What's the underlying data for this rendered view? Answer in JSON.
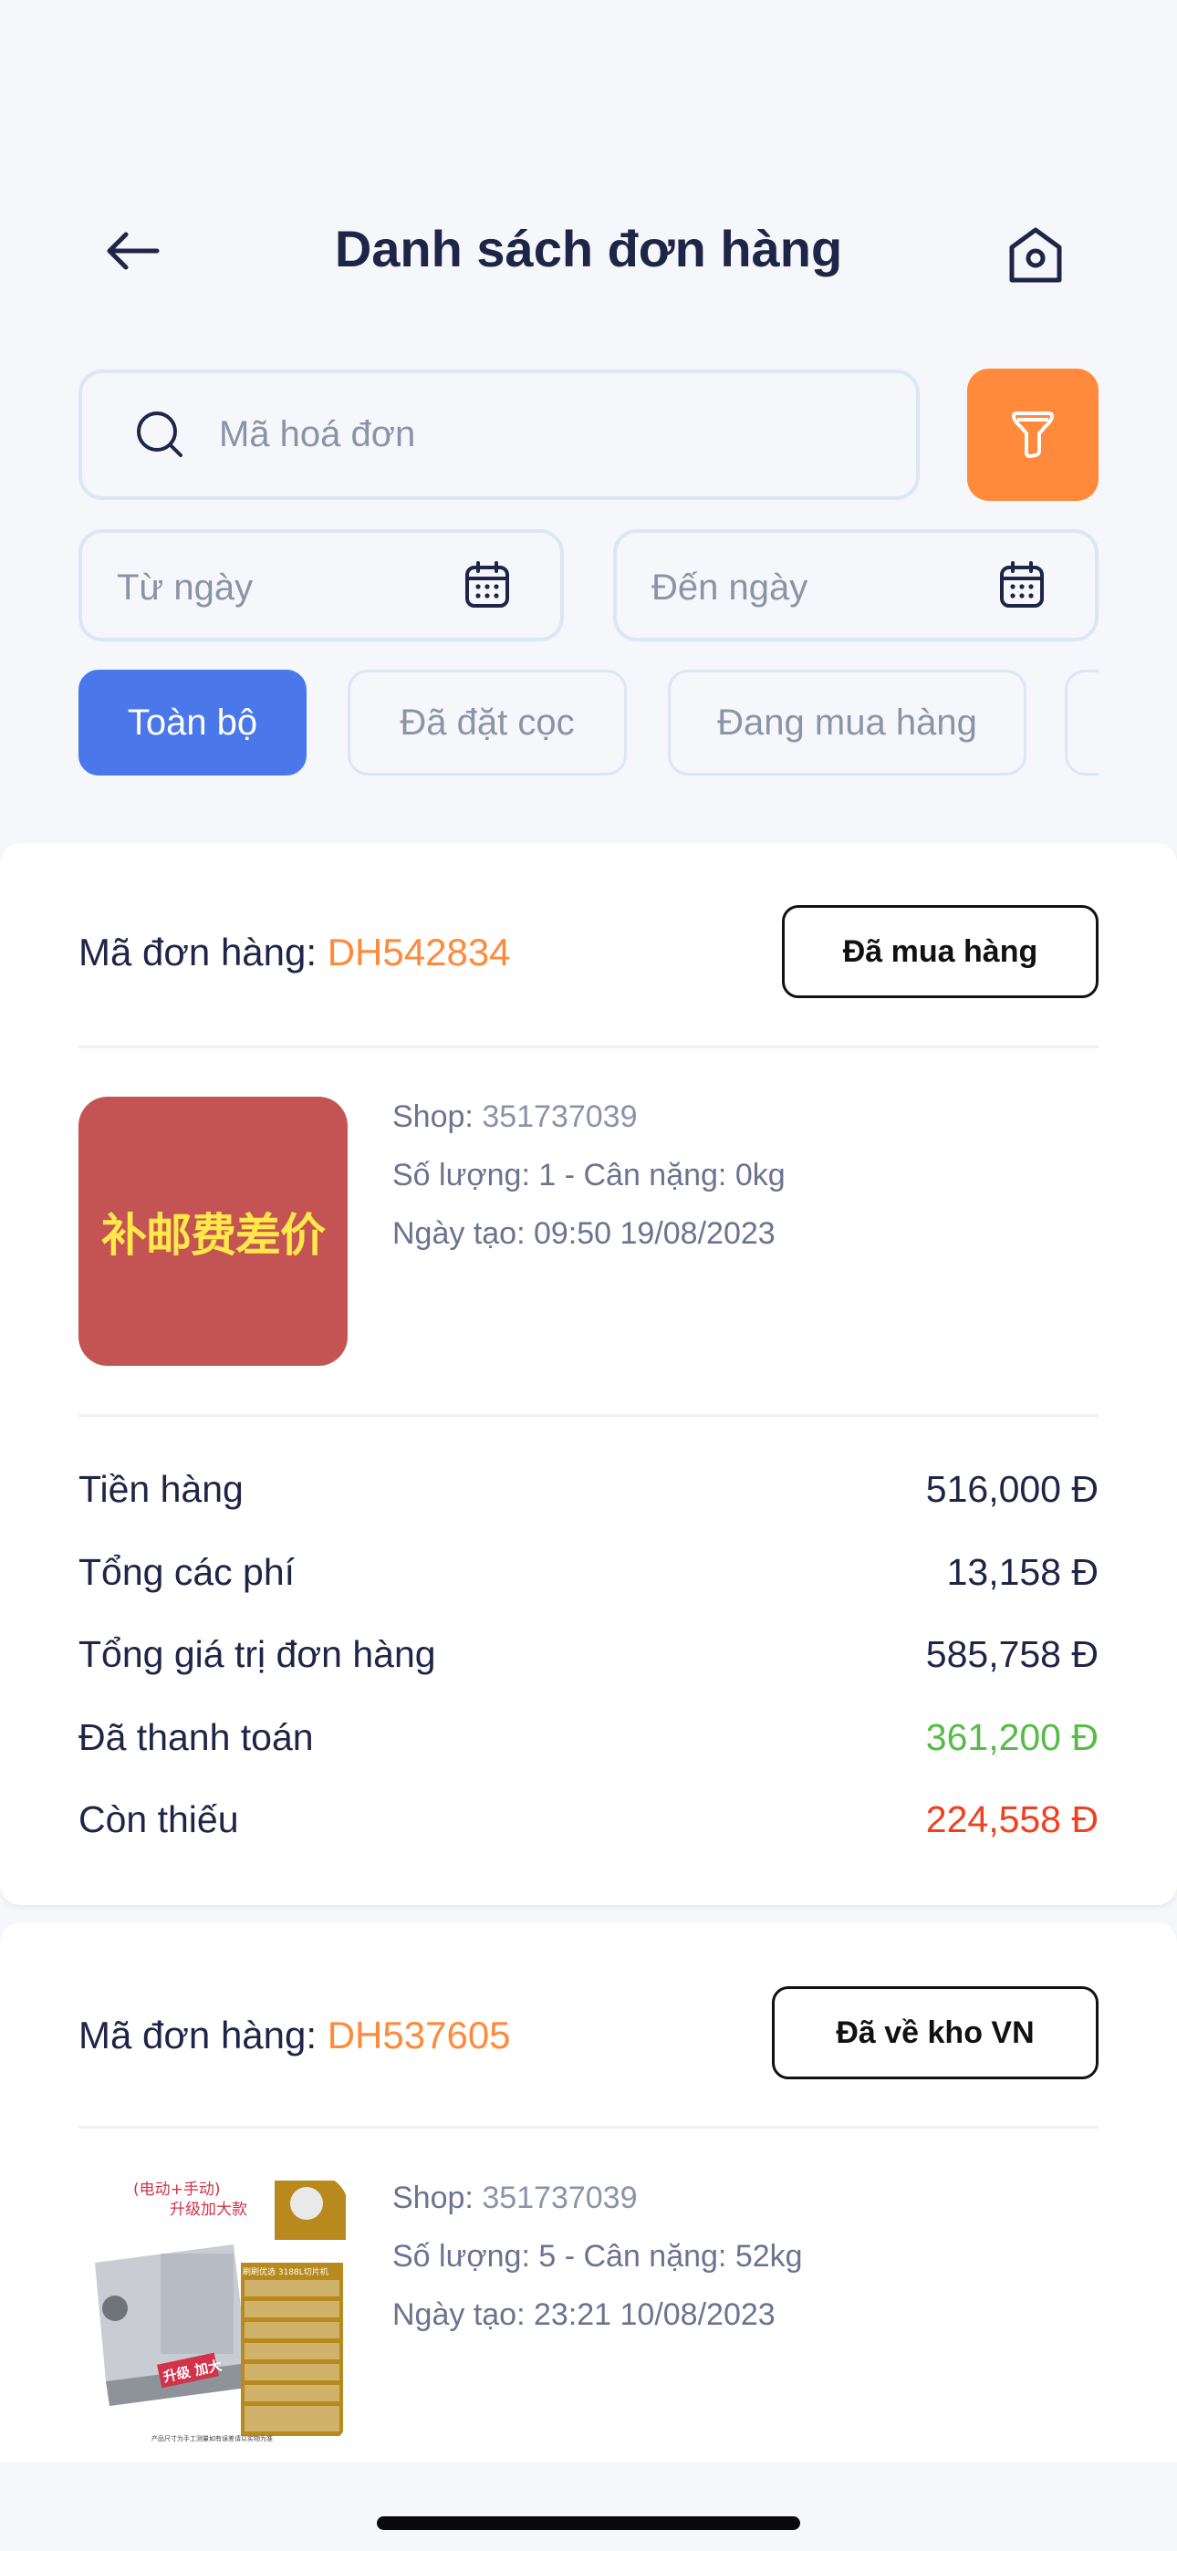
{
  "header": {
    "title": "Danh sách đơn hàng",
    "back_icon": "arrow-left-icon",
    "home_icon": "home-icon"
  },
  "search": {
    "placeholder": "Mã hoá đơn",
    "filter_icon": "funnel-icon"
  },
  "date_filter": {
    "from_label": "Từ ngày",
    "to_label": "Đến ngày"
  },
  "tabs": [
    {
      "label": "Toàn bộ",
      "active": true
    },
    {
      "label": "Đã đặt cọc",
      "active": false
    },
    {
      "label": "Đang mua hàng",
      "active": false
    },
    {
      "label": "",
      "active": false
    }
  ],
  "orders": [
    {
      "code_label": "Mã đơn hàng: ",
      "code": "DH542834",
      "status": "Đã mua hàng",
      "image_text": "补邮费差价",
      "shop_label": "Shop:",
      "shop": "351737039",
      "qty_weight": "Số lượng: 1 - Cân nặng: 0kg",
      "created": "Ngày tạo: 09:50 19/08/2023",
      "summary": [
        {
          "label": "Tiền hàng",
          "value": "516,000 Đ",
          "tone": "normal"
        },
        {
          "label": "Tổng các phí",
          "value": "13,158 Đ",
          "tone": "normal"
        },
        {
          "label": "Tổng giá trị đơn hàng",
          "value": "585,758 Đ",
          "tone": "normal"
        },
        {
          "label": "Đã thanh toán",
          "value": "361,200 Đ",
          "tone": "green"
        },
        {
          "label": "Còn thiếu",
          "value": "224,558 Đ",
          "tone": "red"
        }
      ]
    },
    {
      "code_label": "Mã đơn hàng: ",
      "code": "DH537605",
      "status": "Đã về kho VN",
      "image_text": {
        "top_red": "(电动+手动)",
        "top_red_2": "升级加大款",
        "badge": "升级 加大",
        "table_title": "刷刷优选 3188L切片机",
        "footnote": "产品尺寸为手工测量如有误差请以实物为准"
      },
      "shop_label": "Shop:",
      "shop": "351737039",
      "qty_weight": "Số lượng: 5 - Cân nặng: 52kg",
      "created": "Ngày tạo: 23:21 10/08/2023"
    }
  ],
  "colors": {
    "accent_orange": "#ff8a3b",
    "accent_blue": "#4a78eb",
    "paid_green": "#57bb47",
    "owed_red": "#f0401f",
    "text_dark": "#1f2547"
  }
}
